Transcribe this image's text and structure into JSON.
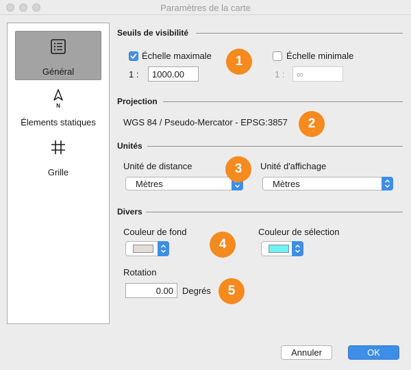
{
  "window": {
    "title": "Paramètres de la carte"
  },
  "sidebar": {
    "items": [
      {
        "label": "Général",
        "icon": "list-icon",
        "active": true
      },
      {
        "label": "Élements statiques",
        "icon": "north-arrow-icon",
        "active": false
      },
      {
        "label": "Grille",
        "icon": "grid-icon",
        "active": false
      }
    ]
  },
  "visibility": {
    "title": "Seuils de visibilité",
    "max": {
      "label": "Échelle maximale",
      "checked": true,
      "prefix": "1 :",
      "value": "1000.00"
    },
    "min": {
      "label": "Échelle minimale",
      "checked": false,
      "prefix": "1 :",
      "value": "∞"
    }
  },
  "projection": {
    "title": "Projection",
    "value": "WGS 84 / Pseudo-Mercator - EPSG:3857"
  },
  "units": {
    "title": "Unités",
    "distance": {
      "label": "Unité de distance",
      "value": "Mètres"
    },
    "display": {
      "label": "Unité d'affichage",
      "value": "Mètres"
    }
  },
  "misc": {
    "title": "Divers",
    "bg_color": {
      "label": "Couleur de fond",
      "color": "#e3ddd6"
    },
    "sel_color": {
      "label": "Couleur de sélection",
      "color": "#6ff2f6"
    },
    "rotation": {
      "label": "Rotation",
      "value": "0.00",
      "unit": "Degrés"
    }
  },
  "badges": [
    "1",
    "2",
    "3",
    "4",
    "5"
  ],
  "buttons": {
    "cancel": "Annuler",
    "ok": "OK"
  },
  "colors": {
    "accent": "#3d8ee6",
    "badge": "#f58a1f"
  }
}
